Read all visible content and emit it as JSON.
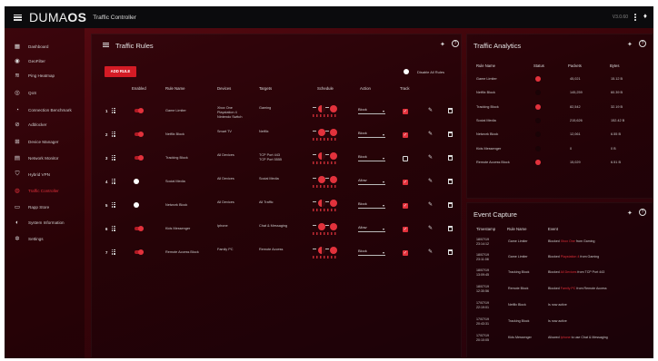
{
  "app": {
    "logo_prefix": "DUMA",
    "logo_bold": "OS",
    "title": "Traffic Controller",
    "version": "V3.0.60"
  },
  "sidebar": [
    {
      "label": "Dashboard",
      "icon": "dashboard-icon",
      "glyph": "▦"
    },
    {
      "label": "GeoFilter",
      "icon": "geofilter-icon",
      "glyph": "◉"
    },
    {
      "label": "Ping Heatmap",
      "icon": "ping-heatmap-icon",
      "glyph": "≋"
    },
    {
      "label": "QoS",
      "icon": "qos-icon",
      "glyph": "◎"
    },
    {
      "label": "Connection Benchmark",
      "icon": "benchmark-icon",
      "glyph": "◔"
    },
    {
      "label": "Adblocker",
      "icon": "adblocker-icon",
      "glyph": "⊘"
    },
    {
      "label": "Device Manager",
      "icon": "device-manager-icon",
      "glyph": "⊞"
    },
    {
      "label": "Network Monitor",
      "icon": "network-monitor-icon",
      "glyph": "▤"
    },
    {
      "label": "Hybrid VPN",
      "icon": "vpn-shield-icon",
      "glyph": "⛉"
    },
    {
      "label": "Traffic Controller",
      "icon": "traffic-controller-icon",
      "glyph": "◍",
      "active": true
    },
    {
      "label": "Rapp Store",
      "icon": "rapp-store-icon",
      "glyph": "▭"
    },
    {
      "label": "System Information",
      "icon": "system-info-icon",
      "glyph": "◐"
    },
    {
      "label": "Settings",
      "icon": "settings-gear-icon",
      "glyph": "✲"
    }
  ],
  "traffic_rules": {
    "title": "Traffic Rules",
    "add_rule": "ADD RULE",
    "disable_all": "Disable All Rules",
    "headers": {
      "enabled": "Enabled",
      "rule_name": "Rule Name",
      "devices": "Devices",
      "targets": "Targets",
      "schedule": "Schedule",
      "action": "Action",
      "track": "Track"
    },
    "rows": [
      {
        "num": "1",
        "enabled": true,
        "name": "Game Limiter",
        "devices": [
          "Xbox One",
          "Playstation 4",
          "Nintendo Switch"
        ],
        "targets": [
          "Gaming"
        ],
        "action": "Block",
        "track": true
      },
      {
        "num": "2",
        "enabled": true,
        "name": "Netflix Block",
        "devices": [
          "Smart TV"
        ],
        "targets": [
          "Netflix"
        ],
        "action": "Block",
        "track": true
      },
      {
        "num": "3",
        "enabled": true,
        "name": "Tracking Block",
        "devices": [
          "All Devices"
        ],
        "targets": [
          "TCP Port 443",
          "TCP Port 5555"
        ],
        "action": "Block",
        "track": false
      },
      {
        "num": "4",
        "enabled": false,
        "name": "Social Media",
        "devices": [
          "All Devices"
        ],
        "targets": [
          "Social Media"
        ],
        "action": "Allow",
        "track": true
      },
      {
        "num": "5",
        "enabled": false,
        "name": "Network Block",
        "devices": [
          "All Devices"
        ],
        "targets": [
          "All Traffic"
        ],
        "action": "Block",
        "track": true
      },
      {
        "num": "6",
        "enabled": true,
        "name": "Kids Messenger",
        "devices": [
          "Iphone"
        ],
        "targets": [
          "Chat & Messaging"
        ],
        "action": "Allow",
        "track": true
      },
      {
        "num": "7",
        "enabled": true,
        "name": "Remote Access Block",
        "devices": [
          "Family PC"
        ],
        "targets": [
          "Remote Access"
        ],
        "action": "Block",
        "track": true
      }
    ]
  },
  "analytics": {
    "title": "Traffic Analytics",
    "headers": {
      "rule": "Rule Name",
      "status": "Status",
      "packets": "Packets",
      "bytes": "Bytes"
    },
    "rows": [
      {
        "rule": "Game Limiter",
        "status": "active",
        "packets": "45,021",
        "bytes": "15.12 B"
      },
      {
        "rule": "Netflix Block",
        "status": "inactive",
        "packets": "145,259",
        "bytes": "60.39 B"
      },
      {
        "rule": "Tracking Block",
        "status": "active",
        "packets": "82,542",
        "bytes": "32.19 B"
      },
      {
        "rule": "Social Media",
        "status": "inactive",
        "packets": "215,626",
        "bytes": "152.42 B"
      },
      {
        "rule": "Network Block",
        "status": "inactive",
        "packets": "12,061",
        "bytes": "6.55 B"
      },
      {
        "rule": "Kids Messenger",
        "status": "inactive",
        "packets": "0",
        "bytes": "0 B"
      },
      {
        "rule": "Remote Access Block",
        "status": "active",
        "packets": "15,029",
        "bytes": "6.51 B"
      }
    ]
  },
  "events": {
    "title": "Event Capture",
    "headers": {
      "timestamp": "Timestamp",
      "rule": "Rule Name",
      "event": "Event"
    },
    "rows": [
      {
        "date": "18/07/19",
        "time": "23:14:12",
        "rule": "Game Limiter",
        "pre": "Blocked ",
        "hl": "Xbox One",
        "post": " from Gaming"
      },
      {
        "date": "18/07/19",
        "time": "23:11:08",
        "rule": "Game Limiter",
        "pre": "Blocked ",
        "hl": "Playstation 4",
        "post": " from Gaming"
      },
      {
        "date": "18/07/19",
        "time": "13:09:45",
        "rule": "Tracking Block",
        "pre": "Blocked ",
        "hl": "All Devices",
        "post": " from TCP Port 443"
      },
      {
        "date": "18/07/19",
        "time": "12:30:56",
        "rule": "Remote Block",
        "pre": "Blocked ",
        "hl": "Family PC",
        "post": " from Remote Access"
      },
      {
        "date": "17/07/19",
        "time": "22:19:01",
        "rule": "Netflix Block",
        "pre": "Is now active",
        "hl": "",
        "post": ""
      },
      {
        "date": "17/07/19",
        "time": "20:43:31",
        "rule": "Tracking Block",
        "pre": "Is now active",
        "hl": "",
        "post": ""
      },
      {
        "date": "17/07/19",
        "time": "20:10:05",
        "rule": "Kids Messenger",
        "pre": "Allowed ",
        "hl": "Iphone",
        "post": " to use Chat & Messaging"
      }
    ]
  },
  "colors": {
    "accent": "#e2323c",
    "background": "#3a0409",
    "topbar": "#0b0b0d"
  }
}
